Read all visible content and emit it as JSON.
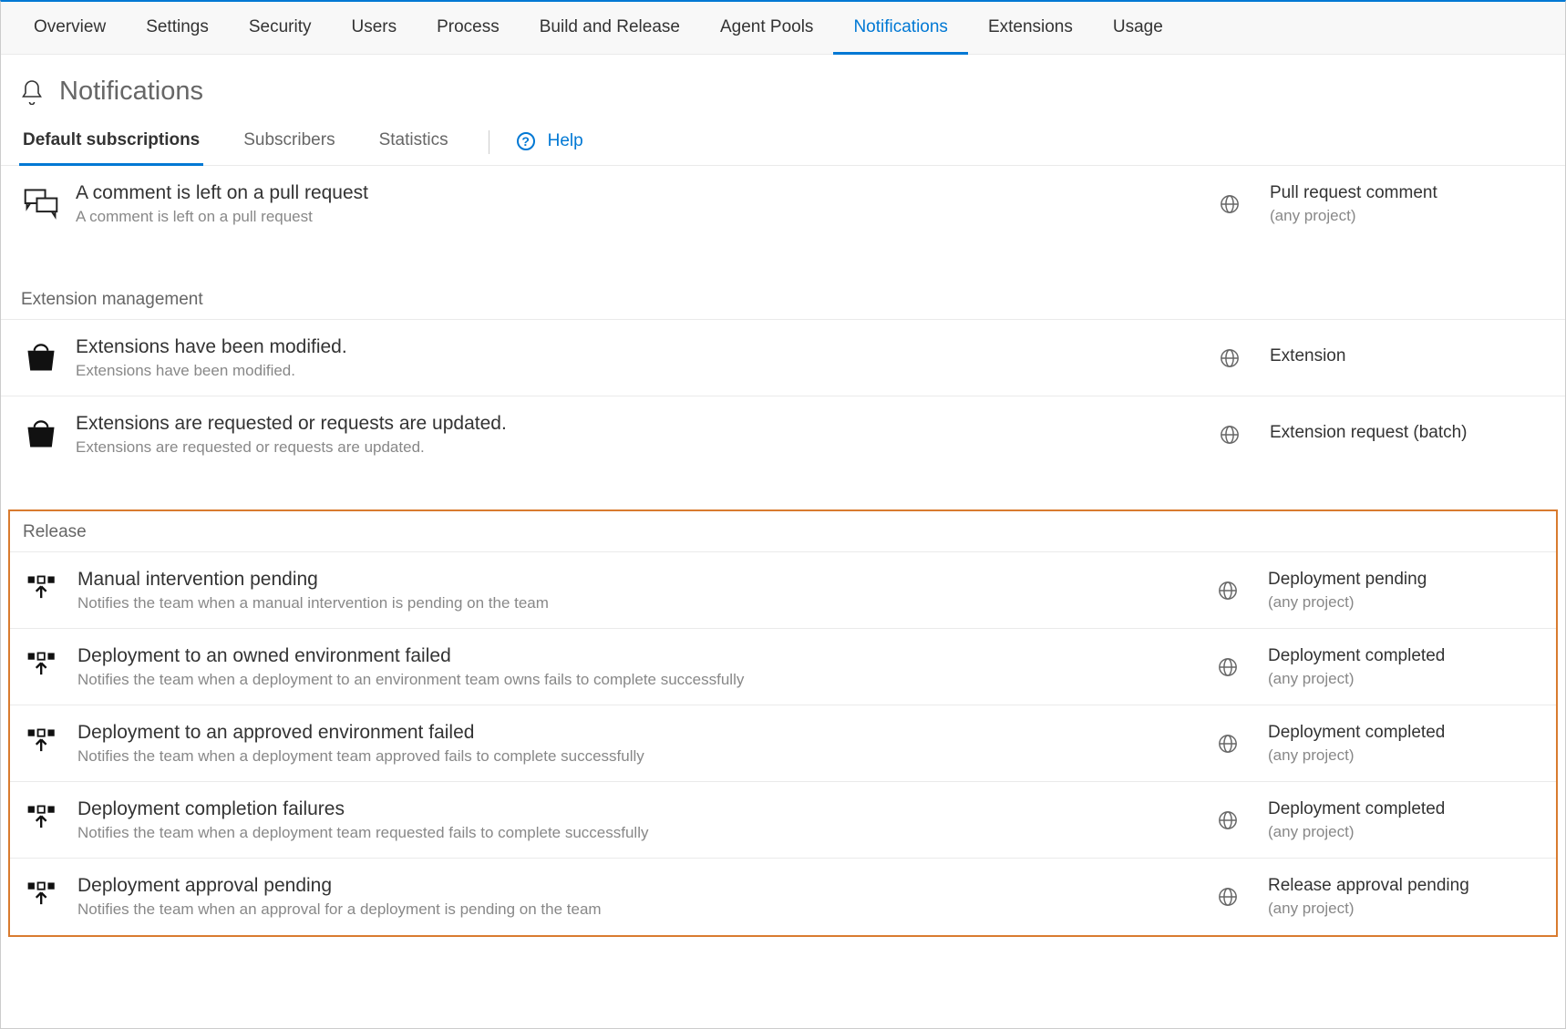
{
  "top_nav": {
    "items": [
      {
        "label": "Overview"
      },
      {
        "label": "Settings"
      },
      {
        "label": "Security"
      },
      {
        "label": "Users"
      },
      {
        "label": "Process"
      },
      {
        "label": "Build and Release"
      },
      {
        "label": "Agent Pools"
      },
      {
        "label": "Notifications",
        "active": true
      },
      {
        "label": "Extensions"
      },
      {
        "label": "Usage"
      }
    ]
  },
  "page": {
    "title": "Notifications"
  },
  "sub_tabs": {
    "items": [
      {
        "label": "Default subscriptions",
        "active": true
      },
      {
        "label": "Subscribers"
      },
      {
        "label": "Statistics"
      }
    ],
    "help_label": "Help"
  },
  "groups": {
    "top_items": [
      {
        "icon": "chat-icon",
        "title": "A comment is left on a pull request",
        "desc": "A comment is left on a pull request",
        "category": "Pull request comment",
        "scope": "(any project)"
      }
    ],
    "extension": {
      "header": "Extension management",
      "items": [
        {
          "icon": "bag-icon",
          "title": "Extensions have been modified.",
          "desc": "Extensions have been modified.",
          "category": "Extension",
          "scope": ""
        },
        {
          "icon": "bag-icon",
          "title": "Extensions are requested or requests are updated.",
          "desc": "Extensions are requested or requests are updated.",
          "category": "Extension request (batch)",
          "scope": ""
        }
      ]
    },
    "release": {
      "header": "Release",
      "items": [
        {
          "icon": "release-icon",
          "title": "Manual intervention pending",
          "desc": "Notifies the team when a manual intervention is pending on the team",
          "category": "Deployment pending",
          "scope": "(any project)"
        },
        {
          "icon": "release-icon",
          "title": "Deployment to an owned environment failed",
          "desc": "Notifies the team when a deployment to an environment team owns fails to complete successfully",
          "category": "Deployment completed",
          "scope": "(any project)"
        },
        {
          "icon": "release-icon",
          "title": "Deployment to an approved environment failed",
          "desc": "Notifies the team when a deployment team approved fails to complete successfully",
          "category": "Deployment completed",
          "scope": "(any project)"
        },
        {
          "icon": "release-icon",
          "title": "Deployment completion failures",
          "desc": "Notifies the team when a deployment team requested fails to complete successfully",
          "category": "Deployment completed",
          "scope": "(any project)"
        },
        {
          "icon": "release-icon",
          "title": "Deployment approval pending",
          "desc": "Notifies the team when an approval for a deployment is pending on the team",
          "category": "Release approval pending",
          "scope": "(any project)"
        }
      ]
    }
  }
}
